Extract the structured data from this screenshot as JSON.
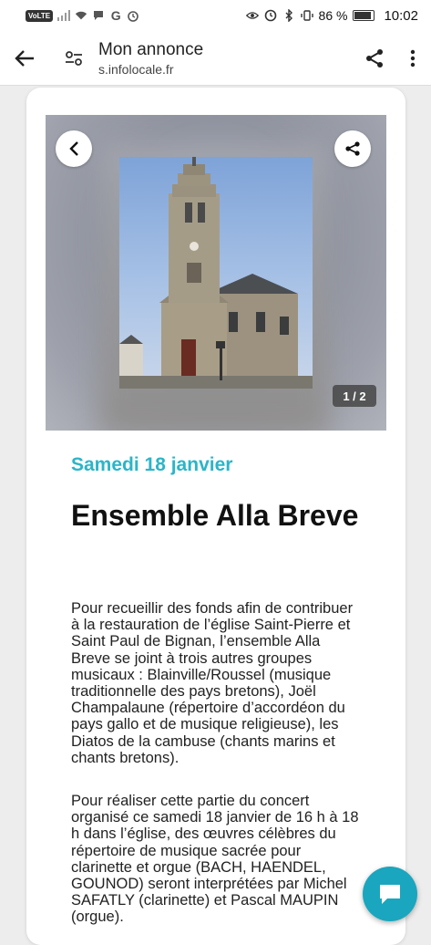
{
  "status_bar": {
    "network_badge": "VoLTE",
    "battery_percent": "86 %",
    "time": "10:02"
  },
  "top_bar": {
    "title": "Mon annonce",
    "url": "s.infolocale.fr"
  },
  "carousel": {
    "counter": "1 / 2"
  },
  "event": {
    "date": "Samedi 18 janvier",
    "title": "Ensemble Alla Breve",
    "paragraphs": [
      "Pour recueillir des fonds afin de contribuer à la restauration de l’église Saint-Pierre et Saint Paul de Bignan, l’ensemble Alla Breve se joint à trois autres groupes musicaux : Blainville/Roussel (musique traditionnelle des pays bretons), Joël Champalaune (répertoire d’accordéon du pays gallo et de musique religieuse), les Diatos de la cambuse (chants marins et chants bretons).",
      "Pour réaliser cette partie du concert organisé ce samedi 18 janvier de 16 h à 18 h dans l’église, des œuvres célèbres du répertoire de musique sacrée pour clarinette et orgue (BACH, HAENDEL, GOUNOD) seront interprétées par Michel SAFATLY (clarinette) et Pascal MAUPIN (orgue)."
    ]
  },
  "colors": {
    "accent": "#2bb5c8",
    "chat_button": "#1aa6be"
  }
}
